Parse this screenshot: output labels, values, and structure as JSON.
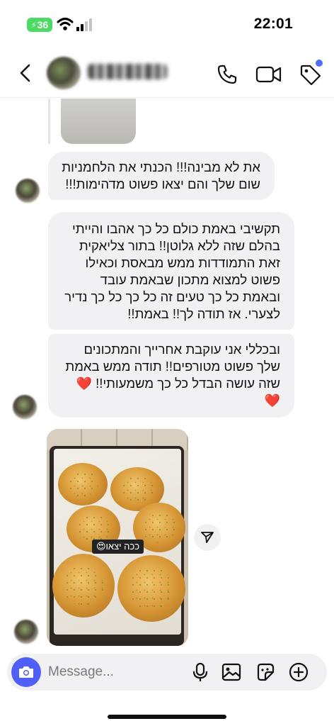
{
  "status_bar": {
    "time": "22:01",
    "battery": "36"
  },
  "header": {
    "contact_name": "",
    "icons": [
      "back-arrow-icon",
      "phone-icon",
      "video-camera-icon",
      "tag-icon"
    ],
    "notification_dot_color": "#4f6ef7"
  },
  "messages": [
    {
      "lines": [
        "את לא מבינה!!! הכנתי את הלחמניות",
        "שום שלך והם יצאו פשוט מדהימות!!!"
      ]
    },
    {
      "lines": [
        "תקשיבי באמת כולם כל כך אהבו והייתי",
        "בהלם שזה ללא גלוטן!! בתור צליאקית",
        "זאת התמודדות ממש מבאסת וכאילו",
        "פשוט למצוא מתכון שבאמת עובד",
        "ובאמת כל כך טעים זה כל כך כל כך נדיר",
        "לצערי. אז תודה לך!! באמת!!"
      ]
    },
    {
      "lines": [
        "ובכללי אני עוקבת אחרייך והמתכונים",
        "שלך פשוט מטורפים!! תודה ממש באמת",
        "שזה עושה הבדל כל כך משמעותי!!"
      ],
      "trailing_emoji": "❤️",
      "extra_line_emoji": "❤️"
    }
  ],
  "photo_message": {
    "sticker_text": "ככה יצאו😍"
  },
  "composer": {
    "placeholder": "Message..."
  },
  "colors": {
    "accent": "#4f5ff7",
    "bubble": "#f1f1f3"
  }
}
